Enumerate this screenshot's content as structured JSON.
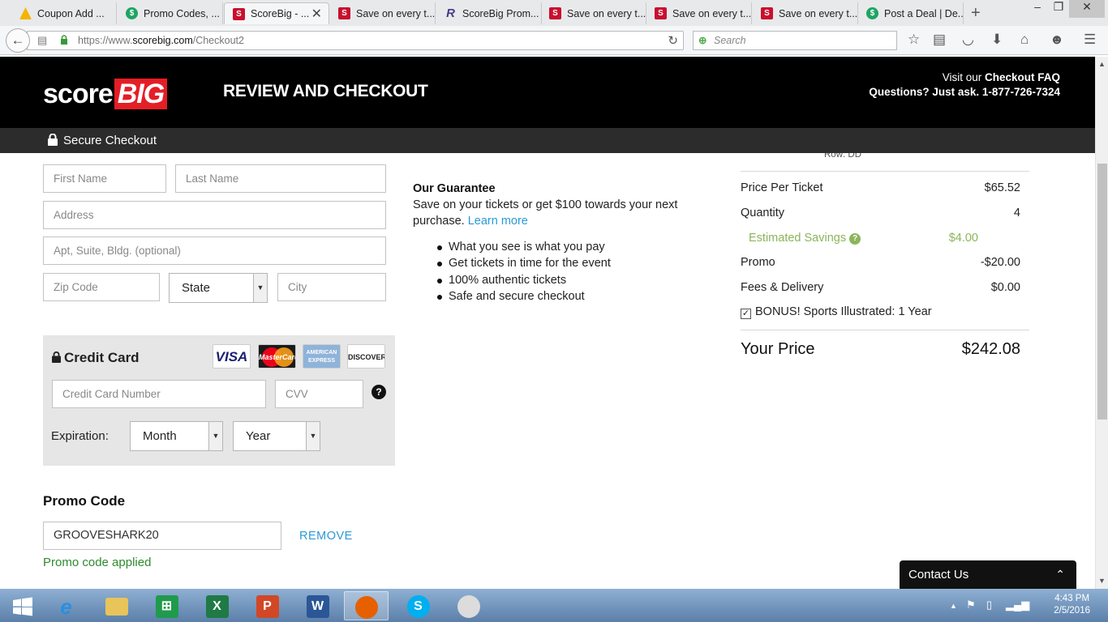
{
  "browser": {
    "tabs": [
      {
        "title": "Coupon Add ...",
        "icon": "google-drive-icon"
      },
      {
        "title": "Promo Codes, ...",
        "icon": "dollar-icon"
      },
      {
        "title": "ScoreBig - ...",
        "icon": "scorebig-icon",
        "active": true
      },
      {
        "title": "Save on every t...",
        "icon": "scorebig-icon"
      },
      {
        "title": "ScoreBig Prom...",
        "icon": "retailmenot-icon"
      },
      {
        "title": "Save on every t...",
        "icon": "scorebig-icon"
      },
      {
        "title": "Save on every t...",
        "icon": "scorebig-icon"
      },
      {
        "title": "Save on every t...",
        "icon": "scorebig-icon"
      },
      {
        "title": "Post a Deal | De...",
        "icon": "dollar-icon"
      }
    ],
    "url_prefix": "https://www.",
    "url_domain": "scorebig.com",
    "url_path": "/Checkout2",
    "search_placeholder": "Search"
  },
  "header": {
    "logo_score": "score",
    "logo_big": "BIG",
    "title": "REVIEW AND CHECKOUT",
    "faq_prefix": "Visit our ",
    "faq_link": "Checkout FAQ",
    "questions": "Questions? Just ask. 1-877-726-7324"
  },
  "secure_bar": {
    "label": "Secure Checkout"
  },
  "form": {
    "first_name_placeholder": "First Name",
    "last_name_placeholder": "Last Name",
    "address_placeholder": "Address",
    "apt_placeholder": "Apt, Suite, Bldg. (optional)",
    "zip_placeholder": "Zip Code",
    "state_value": "State",
    "city_placeholder": "City"
  },
  "credit_card": {
    "title": "Credit Card",
    "cards": [
      "VISA",
      "MasterCard",
      "AMERICAN EXPRESS",
      "DISCOVER"
    ],
    "number_placeholder": "Credit Card Number",
    "cvv_placeholder": "CVV",
    "expiration_label": "Expiration:",
    "month_value": "Month",
    "year_value": "Year"
  },
  "promo": {
    "title": "Promo Code",
    "value": "GROOVESHARK20",
    "remove_label": "REMOVE",
    "status": "Promo code applied"
  },
  "guarantee": {
    "title": "Our Guarantee",
    "text": "Save on your tickets or get $100 towards your next purchase.",
    "link": "Learn more",
    "bullets": [
      "What you see is what you pay",
      "Get tickets in time for the event",
      "100% authentic tickets",
      "Safe and secure checkout"
    ]
  },
  "summary": {
    "row_label": "Row: DD",
    "price_per_ticket_label": "Price Per Ticket",
    "price_per_ticket": "$65.52",
    "quantity_label": "Quantity",
    "quantity": "4",
    "savings_label": "Estimated Savings",
    "savings": "$4.00",
    "promo_label": "Promo",
    "promo": "-$20.00",
    "fees_label": "Fees & Delivery",
    "fees": "$0.00",
    "bonus_label": "BONUS! Sports Illustrated: 1 Year",
    "your_price_label": "Your Price",
    "your_price": "$242.08",
    "accent_color": "#8bb55a"
  },
  "contact": {
    "label": "Contact Us"
  },
  "taskbar": {
    "time": "4:43 PM",
    "date": "2/5/2016"
  }
}
